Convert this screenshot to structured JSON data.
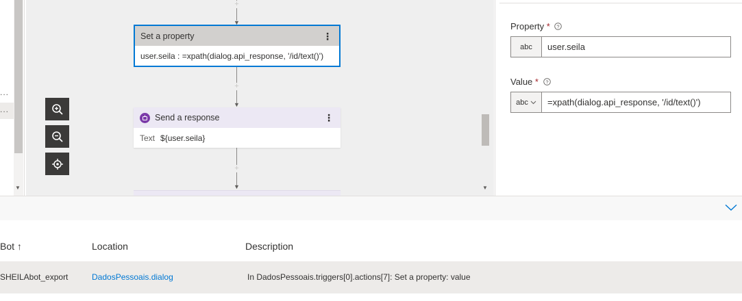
{
  "left_nav": {
    "ellipsis_1": "...",
    "ellipsis_2": "..."
  },
  "canvas": {
    "zoom_controls": [
      "zoom-in-icon",
      "zoom-out-icon",
      "center-icon"
    ],
    "node_set_property": {
      "title": "Set a property",
      "content": "user.seila : =xpath(dialog.api_response, '/id/text()')",
      "menu_glyph": "⋮"
    },
    "node_send_response": {
      "title": "Send a response",
      "content_label": "Text",
      "content_value": "${user.seila}",
      "menu_glyph": "⋮"
    },
    "plus_glyph": "+"
  },
  "properties": {
    "property": {
      "label": "Property",
      "required_mark": "*",
      "type": "abc",
      "value": "user.seila"
    },
    "value": {
      "label": "Value",
      "required_mark": "*",
      "type": "abc",
      "value": "=xpath(dialog.api_response, '/id/text()')"
    }
  },
  "problems_table": {
    "columns": [
      "Bot ↑",
      "Location",
      "Description"
    ],
    "rows": [
      {
        "bot": "SHEILAbot_export",
        "location": "DadosPessoais.dialog",
        "description": "In DadosPessoais.triggers[0].actions[7]: Set a property: value"
      }
    ]
  },
  "colors": {
    "accent": "#0078d4",
    "selected_border": "#0078d4",
    "required": "#a4262c",
    "bot_icon": "#7b3aa8"
  }
}
